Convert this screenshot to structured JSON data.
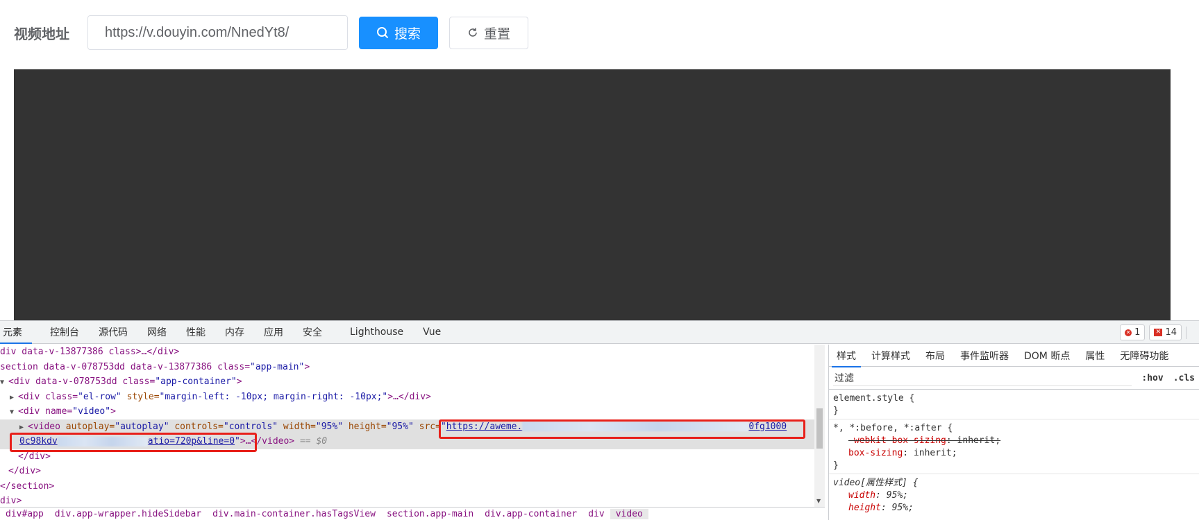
{
  "page": {
    "field_label": "视频地址",
    "url_value": "https://v.douyin.com/NnedYt8/",
    "search_label": "搜索",
    "reset_label": "重置",
    "primary_color": "#1890ff"
  },
  "devtools": {
    "tabs": [
      "元素",
      "控制台",
      "源代码",
      "网络",
      "性能",
      "内存",
      "应用",
      "安全",
      "Lighthouse",
      "Vue"
    ],
    "error_count": "1",
    "issue_count": "14",
    "elements": {
      "line1_a": "div data-v-13877386 class>…</div>",
      "line2_tag": "section data-v-078753dd data-v-13877386 class=",
      "line2_val": "\"app-main\"",
      "line3_tag": "div data-v-078753dd class=",
      "line3_val": "\"app-container\"",
      "line4_tag": "div class=",
      "line4_val": "\"el-row\"",
      "line4_style_n": "style=",
      "line4_style_v": "\"margin-left: -10px; margin-right: -10px;\"",
      "line4_end": ">…</div>",
      "line5_tag": "div name=",
      "line5_val": "\"video\"",
      "video_open": "<video",
      "video_autoplay_n": "autoplay=",
      "video_autoplay_v": "\"autoplay\"",
      "video_controls_n": "controls=",
      "video_controls_v": "\"controls\"",
      "video_width_n": "width=",
      "video_width_v": "\"95%\"",
      "video_height_n": "height=",
      "video_height_v": "\"95%\"",
      "video_src_n": "src=",
      "video_src_start": "https://aweme.",
      "video_src_mid": "0fg1000",
      "video_src_line2_a": "0c98kdv",
      "video_src_line2_b": "atio=720p&line=0",
      "video_close": ">…</video>",
      "eq_dollar": "== $0",
      "close_div": "</div>",
      "close_div2": "</div>",
      "close_section": "</section>",
      "close_div3": "div>"
    },
    "breadcrumb": [
      "div#app",
      "div.app-wrapper.hideSidebar",
      "div.main-container.hasTagsView",
      "section.app-main",
      "div.app-container",
      "div",
      "video"
    ],
    "styles": {
      "tabs": [
        "样式",
        "计算样式",
        "布局",
        "事件监听器",
        "DOM 断点",
        "属性",
        "无障碍功能"
      ],
      "filter_placeholder": "过滤",
      "hov": ":hov",
      "cls": ".cls",
      "rule1_selector": "element.style {",
      "rule1_close": "}",
      "rule2_selector": "*, *:before, *:after {",
      "rule2_prop1_name": "-webkit-box-sizing",
      "rule2_prop1_val": "inherit;",
      "rule2_prop2_name": "box-sizing",
      "rule2_prop2_val": "inherit;",
      "rule2_close": "}",
      "rule3_selector": "video[属性样式] {",
      "rule3_prop1_name": "width",
      "rule3_prop1_val": "95%;",
      "rule3_prop2_name": "height",
      "rule3_prop2_val": "95%;"
    },
    "highlight_color": "#e8201a"
  }
}
